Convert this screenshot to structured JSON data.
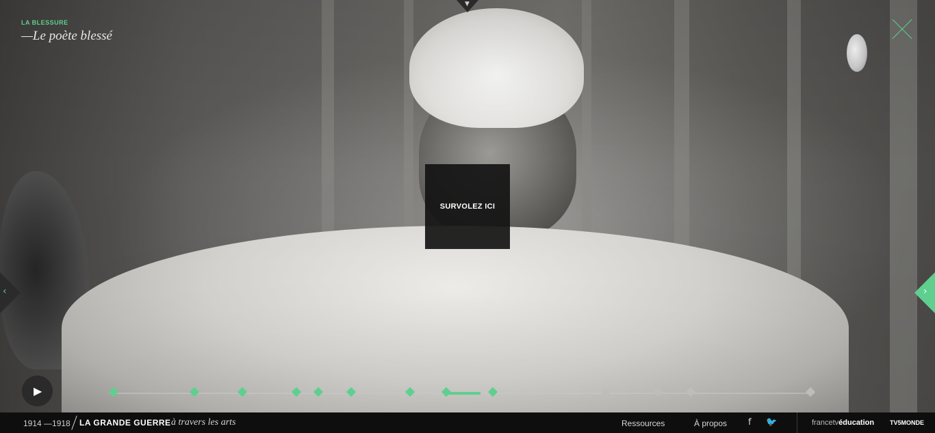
{
  "chapter": {
    "kicker": "LA BLESSURE",
    "title": "—Le poète blessé"
  },
  "hover_box": {
    "label": "SURVOLEZ ICI"
  },
  "icons": {
    "top": "chevron-down-icon",
    "close": "close-icon",
    "left": "chevron-left-icon",
    "right": "chevron-right-icon",
    "play": "play-icon",
    "facebook": "facebook-icon",
    "twitter": "twitter-icon"
  },
  "timeline": {
    "active_index": 8,
    "steps_total": 14,
    "steps_done": 9
  },
  "footer": {
    "dates": "1914 —1918",
    "brand": "LA GRANDE GUERRE",
    "brand_sub": "à travers les arts",
    "links": [
      "Ressources",
      "À propos"
    ],
    "partners": {
      "ftv_prefix": "francetv",
      "ftv_suffix": "éducation",
      "tv5": "TV5MONDE"
    }
  },
  "colors": {
    "accent": "#5fcf8f",
    "bar": "#0e0e0e"
  }
}
